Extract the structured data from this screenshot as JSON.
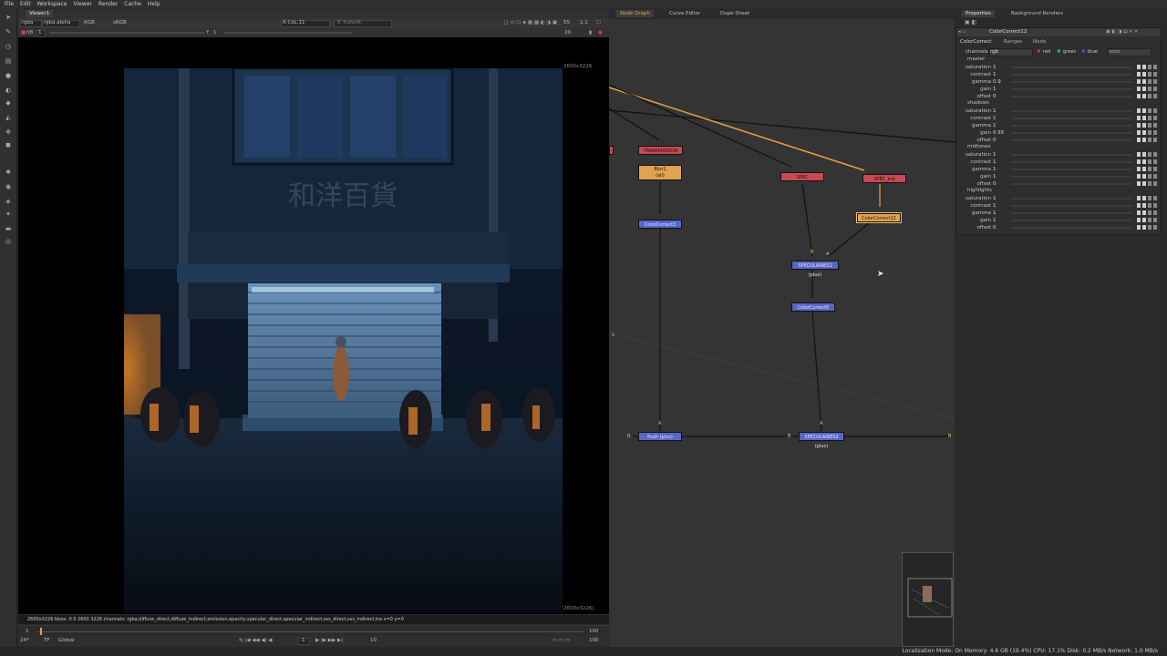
{
  "menu": [
    "File",
    "Edit",
    "Workspace",
    "Viewer",
    "Render",
    "Cache",
    "Help"
  ],
  "viewer": {
    "tab": "Viewer1",
    "channels": "rgba",
    "alpha": "rgba.alpha",
    "colorspace": "RGB",
    "lut": "sRGB",
    "input_a": "A  CoL.11",
    "input_b": "B  TraNsMi",
    "zoom": "55",
    "proxy": "1:1",
    "frame_label": "f/8",
    "frame_num": "1",
    "gain_label": "Y",
    "gain_value": "1",
    "fps_value": "20",
    "res_top": "2600x3226",
    "res_bottom": "(2600x3226)",
    "status": "2600x3226   bbox: 0 0 2600 3226  channels: rgba,diffuse_direct,diffuse_indirect,emission,opacity,specular_direct,specular_indirect,sss_direct,sss_indirect,tra  x=0 y=0",
    "timeline_start": "1",
    "timeline_end": "100",
    "fps": "24*",
    "tf": "TF",
    "scope": "Global",
    "current_frame": "1",
    "step": "10",
    "end_frame": "100"
  },
  "node_graph": {
    "tabs": [
      "Node Graph",
      "Curve Editor",
      "Dope Sheet"
    ],
    "nodes": {
      "transmission": "TRANSMISSION",
      "blur1": "Blur1",
      "blur1_sub": "(all)",
      "colorcorrect3": "ColorCorrect3",
      "spec": "SPEC",
      "spec_ind": "SPEC_ind",
      "colorcorrect12": "ColorCorrect12",
      "speculaires1": "SPECULAIRES1 (plus)",
      "colorcorrect5": "ColorCorrect5",
      "push": "Push (plus)",
      "speculaires2": "SPECULAIRES2 (plus)"
    },
    "labels": {
      "a": "A",
      "b": "B",
      "one": "1"
    }
  },
  "properties": {
    "tabs": [
      "Properties",
      "Background Renders"
    ],
    "node_name": "ColorCorrect12",
    "subtabs": [
      "ColorCorrect",
      "Ranges",
      "Node"
    ],
    "channels_label": "channels",
    "channels_value": "rgb",
    "chk_red": "red",
    "chk_green": "green",
    "chk_blue": "blue",
    "mask_value": "none",
    "sections": {
      "master": {
        "title": "master",
        "rows": [
          [
            "saturation",
            "1"
          ],
          [
            "contrast",
            "1"
          ],
          [
            "gamma",
            "0.9"
          ],
          [
            "gain",
            "1"
          ],
          [
            "offset",
            "0"
          ]
        ]
      },
      "shadows": {
        "title": "shadows",
        "rows": [
          [
            "saturation",
            "1"
          ],
          [
            "contrast",
            "1"
          ],
          [
            "gamma",
            "1"
          ],
          [
            "gain",
            "0.55"
          ],
          [
            "offset",
            "0"
          ]
        ]
      },
      "midtones": {
        "title": "midtones",
        "rows": [
          [
            "saturation",
            "1"
          ],
          [
            "contrast",
            "1"
          ],
          [
            "gamma",
            "1"
          ],
          [
            "gain",
            "1"
          ],
          [
            "offset",
            "0"
          ]
        ]
      },
      "highlights": {
        "title": "highlights",
        "rows": [
          [
            "saturation",
            "1"
          ],
          [
            "contrast",
            "1"
          ],
          [
            "gamma",
            "1"
          ],
          [
            "gain",
            "1"
          ],
          [
            "offset",
            "0"
          ]
        ]
      }
    }
  },
  "status_bar": "Localization Mode: On Memory: 4.6 GB (19.4%) CPU: 17.1% Disk: 0.2 MB/s Network: 1.0 MB/s",
  "colors": {
    "accent": "#e8a13a",
    "node_red": "#c84a54",
    "node_blue": "#5767c8",
    "node_orange": "#e3a24f"
  },
  "image_sign": "和洋百貨"
}
